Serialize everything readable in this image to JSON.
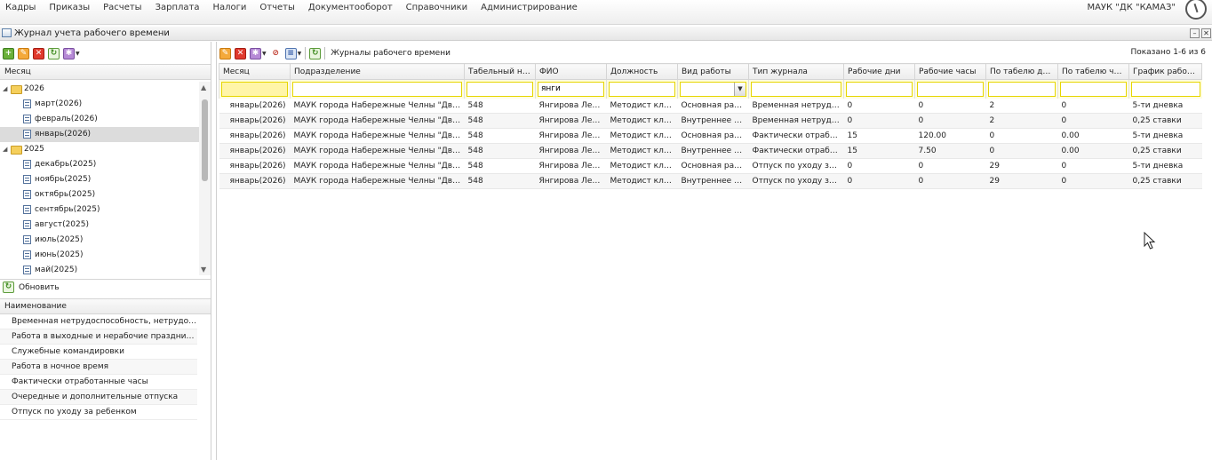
{
  "menu": [
    "Кадры",
    "Приказы",
    "Расчеты",
    "Зарплата",
    "Налоги",
    "Отчеты",
    "Документооборот",
    "Справочники",
    "Администрирование"
  ],
  "org": "МАУК \"ДК \"КАМАЗ\"",
  "window": {
    "title": "Журнал учета рабочего времени",
    "minimize": "–",
    "close": "✕"
  },
  "left": {
    "tree_header": "Месяц",
    "tree": [
      {
        "label": "2026",
        "type": "year",
        "expanded": true
      },
      {
        "label": "март(2026)",
        "type": "month"
      },
      {
        "label": "февраль(2026)",
        "type": "month"
      },
      {
        "label": "январь(2026)",
        "type": "month",
        "selected": true
      },
      {
        "label": "2025",
        "type": "year",
        "expanded": true
      },
      {
        "label": "декабрь(2025)",
        "type": "month"
      },
      {
        "label": "ноябрь(2025)",
        "type": "month"
      },
      {
        "label": "октябрь(2025)",
        "type": "month"
      },
      {
        "label": "сентябрь(2025)",
        "type": "month"
      },
      {
        "label": "август(2025)",
        "type": "month"
      },
      {
        "label": "июль(2025)",
        "type": "month"
      },
      {
        "label": "июнь(2025)",
        "type": "month"
      },
      {
        "label": "май(2025)",
        "type": "month"
      }
    ],
    "refresh_label": "Обновить",
    "names_header": "Наименование",
    "names": [
      "Временная нетрудоспособность, нетрудоспособ...",
      "Работа в выходные и нерабочие праздничные д...",
      "Служебные командировки",
      "Работа в ночное время",
      "Фактически отработанные часы",
      "Очередные и дополнительные отпуска",
      "Отпуск по уходу за ребенком"
    ]
  },
  "right": {
    "toolbar_label": "Журналы рабочего времени",
    "shown": "Показано 1-6 из 6",
    "columns": [
      "Месяц",
      "Подразделение",
      "Табельный ном...",
      "ФИО",
      "Должность",
      "Вид работы",
      "Тип журнала",
      "Рабочие дни",
      "Рабочие часы",
      "По табелю дней",
      "По табелю часов",
      "График рабоче..."
    ],
    "filters": {
      "fio": "янги"
    },
    "rows": [
      [
        "январь(2026)",
        "МАУК города Набережные Челны \"Дворец к...",
        "548",
        "Янгирова Лейл...",
        "Методист клубн...",
        "Основная работа",
        "Временная нетрудосп...",
        "0",
        "0",
        "2",
        "0",
        "5-ти дневка"
      ],
      [
        "январь(2026)",
        "МАУК города Набережные Челны \"Дворец к...",
        "548",
        "Янгирова Лейл...",
        "Методист клубн...",
        "Внутреннее сов...",
        "Временная нетрудосп...",
        "0",
        "0",
        "2",
        "0",
        "0,25 ставки"
      ],
      [
        "январь(2026)",
        "МАУК города Набережные Челны \"Дворец к...",
        "548",
        "Янгирова Лейл...",
        "Методист клубн...",
        "Основная работа",
        "Фактически отработа...",
        "15",
        "120.00",
        "0",
        "0.00",
        "5-ти дневка"
      ],
      [
        "январь(2026)",
        "МАУК города Набережные Челны \"Дворец к...",
        "548",
        "Янгирова Лейл...",
        "Методист клубн...",
        "Внутреннее сов...",
        "Фактически отработа...",
        "15",
        "7.50",
        "0",
        "0.00",
        "0,25 ставки"
      ],
      [
        "январь(2026)",
        "МАУК города Набережные Челны \"Дворец к...",
        "548",
        "Янгирова Лейл...",
        "Методист клубн...",
        "Основная работа",
        "Отпуск по уходу за ре...",
        "0",
        "0",
        "29",
        "0",
        "5-ти дневка"
      ],
      [
        "январь(2026)",
        "МАУК города Набережные Челны \"Дворец к...",
        "548",
        "Янгирова Лейл...",
        "Методист клубн...",
        "Внутреннее сов...",
        "Отпуск по уходу за ре...",
        "0",
        "0",
        "29",
        "0",
        "0,25 ставки"
      ]
    ]
  }
}
